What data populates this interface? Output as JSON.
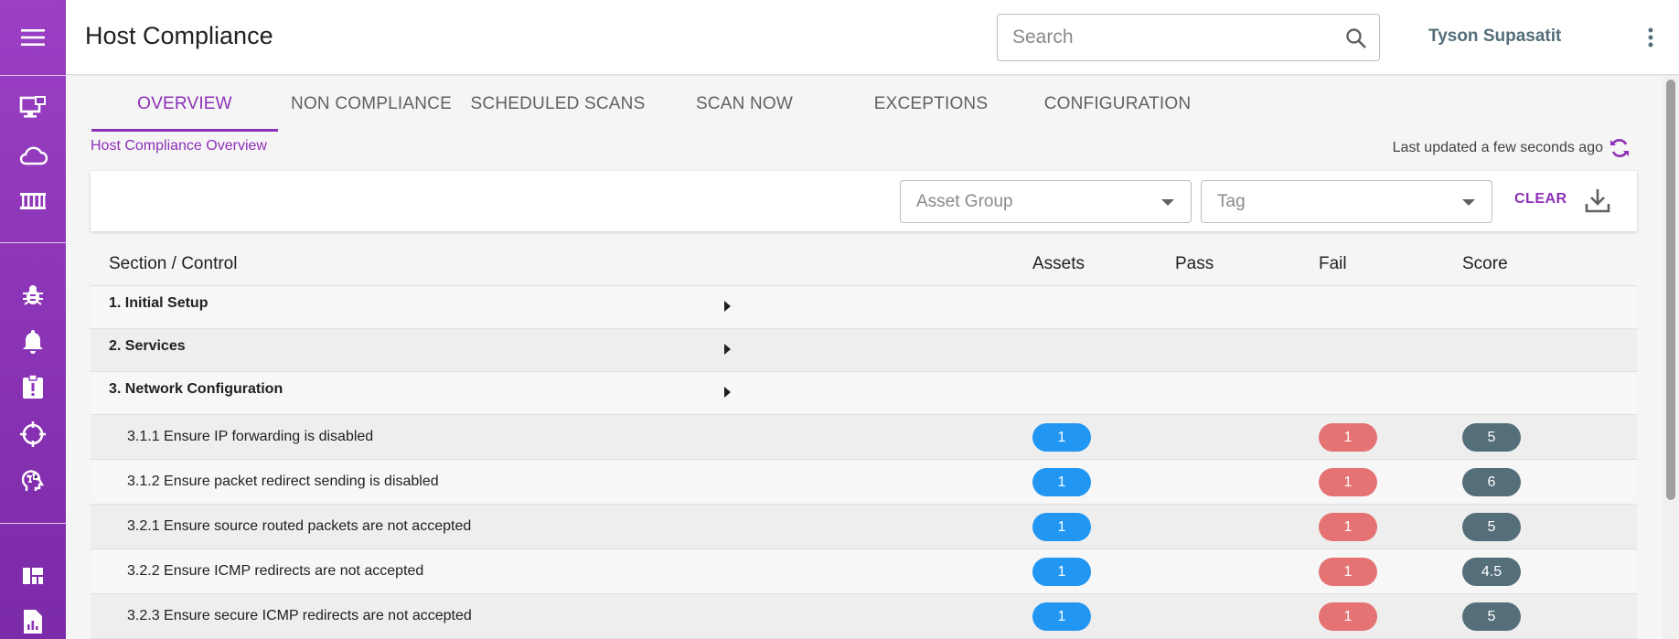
{
  "app": {
    "title": "Host Compliance",
    "search_placeholder": "Search",
    "user_name": "Tyson Supasatit"
  },
  "sidebar": {
    "icons": [
      "menu-icon",
      "desktop-monitor-icon",
      "cloud-icon",
      "container-icon",
      "bug-icon",
      "bell-icon",
      "clipboard-alert-icon",
      "crosshair-icon",
      "brain-icon",
      "dashboard-icon",
      "report-icon"
    ]
  },
  "tabs": [
    "OVERVIEW",
    "NON COMPLIANCE",
    "SCHEDULED SCANS",
    "SCAN NOW",
    "EXCEPTIONS",
    "CONFIGURATION"
  ],
  "active_tab": "OVERVIEW",
  "breadcrumb": "Host Compliance Overview",
  "last_updated": "Last updated a few seconds ago",
  "filters": {
    "asset_group": "Asset Group",
    "tag": "Tag",
    "clear": "CLEAR"
  },
  "table": {
    "headers": {
      "section": "Section / Control",
      "assets": "Assets",
      "pass": "Pass",
      "fail": "Fail",
      "score": "Score"
    },
    "sections": [
      {
        "label": "1. Initial Setup"
      },
      {
        "label": "2. Services"
      },
      {
        "label": "3. Network Configuration"
      }
    ],
    "controls": [
      {
        "label": "3.1.1 Ensure IP forwarding is disabled",
        "assets": "1",
        "fail": "1",
        "score": "5"
      },
      {
        "label": "3.1.2 Ensure packet redirect sending is disabled",
        "assets": "1",
        "fail": "1",
        "score": "6"
      },
      {
        "label": "3.2.1 Ensure source routed packets are not accepted",
        "assets": "1",
        "fail": "1",
        "score": "5"
      },
      {
        "label": "3.2.2 Ensure ICMP redirects are not accepted",
        "assets": "1",
        "fail": "1",
        "score": "4.5"
      },
      {
        "label": "3.2.3 Ensure secure ICMP redirects are not accepted",
        "assets": "1",
        "fail": "1",
        "score": "5"
      }
    ]
  },
  "colors": {
    "brand_purple": "#8e2fb8",
    "assets_pill": "#2196f3",
    "fail_pill": "#e57373",
    "score_pill": "#546e7a"
  }
}
